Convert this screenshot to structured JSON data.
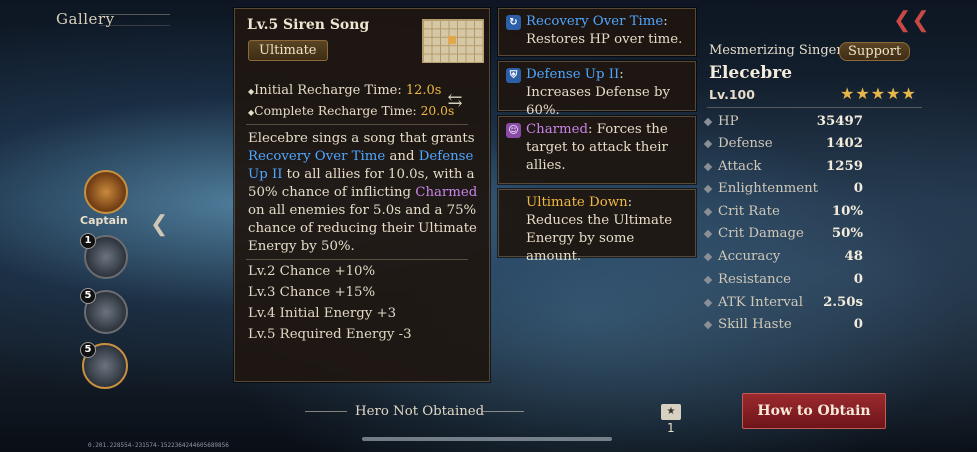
{
  "header": {
    "title": "Gallery"
  },
  "heroes": {
    "captain_label": "Captain",
    "slots": [
      {
        "badge": "1"
      },
      {
        "badge": "5"
      },
      {
        "badge": "5"
      }
    ]
  },
  "skill": {
    "title": "Lv.5 Siren Song",
    "type": "Ultimate",
    "initial_recharge_label": "Initial Recharge Time: ",
    "initial_recharge_value": "12.0s",
    "complete_recharge_label": "Complete Recharge Time: ",
    "complete_recharge_value": "20.0s",
    "desc": {
      "p1": "Elecebre sings a song that grants ",
      "k1": "Recovery Over Time",
      "p2": " and ",
      "k2": "Defense Up II",
      "p3": " to all allies for 10.0s, with a 50% chance of inflicting ",
      "k3": "Charmed",
      "p4": " on all enemies for 5.0s and a 75% chance of reducing their Ultimate Energy by 50%."
    },
    "upgrades": [
      "Lv.2 Chance +10%",
      "Lv.3 Chance +15%",
      "Lv.4 Initial Energy +3",
      "Lv.5 Required Energy -3"
    ]
  },
  "effects": [
    {
      "name": "Recovery Over Time",
      "text": ": Restores HP over time.",
      "color": "#4ea6ff"
    },
    {
      "name": "Defense Up II",
      "text": ": Increases Defense by 60%.",
      "color": "#4ea6ff"
    },
    {
      "name": "Charmed",
      "text": ": Forces the target to attack their allies.",
      "color": "#c884e8"
    },
    {
      "name": "Ultimate Down",
      "text": ": Reduces the Ultimate Energy by some amount.",
      "color": "#f0b742"
    }
  ],
  "character": {
    "subtitle": "Mesmerizing Singer",
    "role": "Support",
    "name": "Elecebre",
    "level": "Lv.100",
    "stars": "★★★★★",
    "stats": [
      {
        "label": "HP",
        "value": "35497"
      },
      {
        "label": "Defense",
        "value": "1402"
      },
      {
        "label": "Attack",
        "value": "1259"
      },
      {
        "label": "Enlightenment",
        "value": "0"
      },
      {
        "label": "Crit Rate",
        "value": "10%"
      },
      {
        "label": "Crit Damage",
        "value": "50%"
      },
      {
        "label": "Accuracy",
        "value": "48"
      },
      {
        "label": "Resistance",
        "value": "0"
      },
      {
        "label": "ATK Interval",
        "value": "2.50s"
      },
      {
        "label": "Skill Haste",
        "value": "0"
      }
    ]
  },
  "footer": {
    "status": "Hero Not Obtained",
    "obtain_button": "How to Obtain",
    "shard_count": "1",
    "version": "0.201.228554-231574-1522364244605689856"
  },
  "colors": {
    "accent_gold": "#f0b742",
    "keyword_blue": "#4ea6ff",
    "keyword_pink": "#c884e8",
    "button_red": "#9b2a2e"
  }
}
